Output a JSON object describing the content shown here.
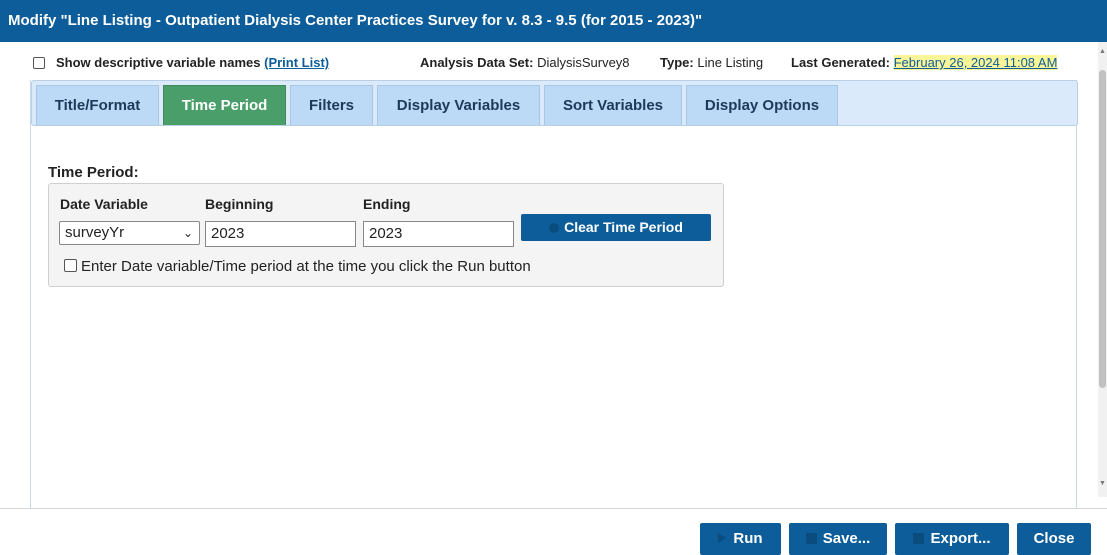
{
  "window": {
    "title": "Modify \"Line Listing - Outpatient Dialysis Center Practices Survey for v. 8.3 - 9.5 (for 2015 - 2023)\""
  },
  "infobar": {
    "show_descriptive_label": "Show descriptive variable names",
    "print_list_label": "(Print List)",
    "analysis_label": "Analysis Data Set:",
    "analysis_value": "DialysisSurvey8",
    "type_label": "Type:",
    "type_value": "Line Listing",
    "last_generated_label": "Last Generated:",
    "last_generated_value": "February 26, 2024 11:08 AM"
  },
  "tabs": [
    {
      "label": "Title/Format",
      "active": false
    },
    {
      "label": "Time Period",
      "active": true
    },
    {
      "label": "Filters",
      "active": false
    },
    {
      "label": "Display Variables",
      "active": false
    },
    {
      "label": "Sort Variables",
      "active": false
    },
    {
      "label": "Display Options",
      "active": false
    }
  ],
  "time_period": {
    "section_label": "Time Period:",
    "date_variable_label": "Date Variable",
    "date_variable_value": "surveyYr",
    "beginning_label": "Beginning",
    "beginning_value": "2023",
    "ending_label": "Ending",
    "ending_value": "2023",
    "clear_button_label": "Clear Time Period",
    "enter_at_run_label": "Enter Date variable/Time period at the time you click the Run button"
  },
  "footer": {
    "run_label": "Run",
    "save_label": "Save...",
    "export_label": "Export...",
    "close_label": "Close"
  },
  "colors": {
    "primary": "#0c5d9a",
    "active_tab": "#4a9e6a",
    "tab": "#bcd9f5",
    "highlight": "#fbf59a"
  }
}
